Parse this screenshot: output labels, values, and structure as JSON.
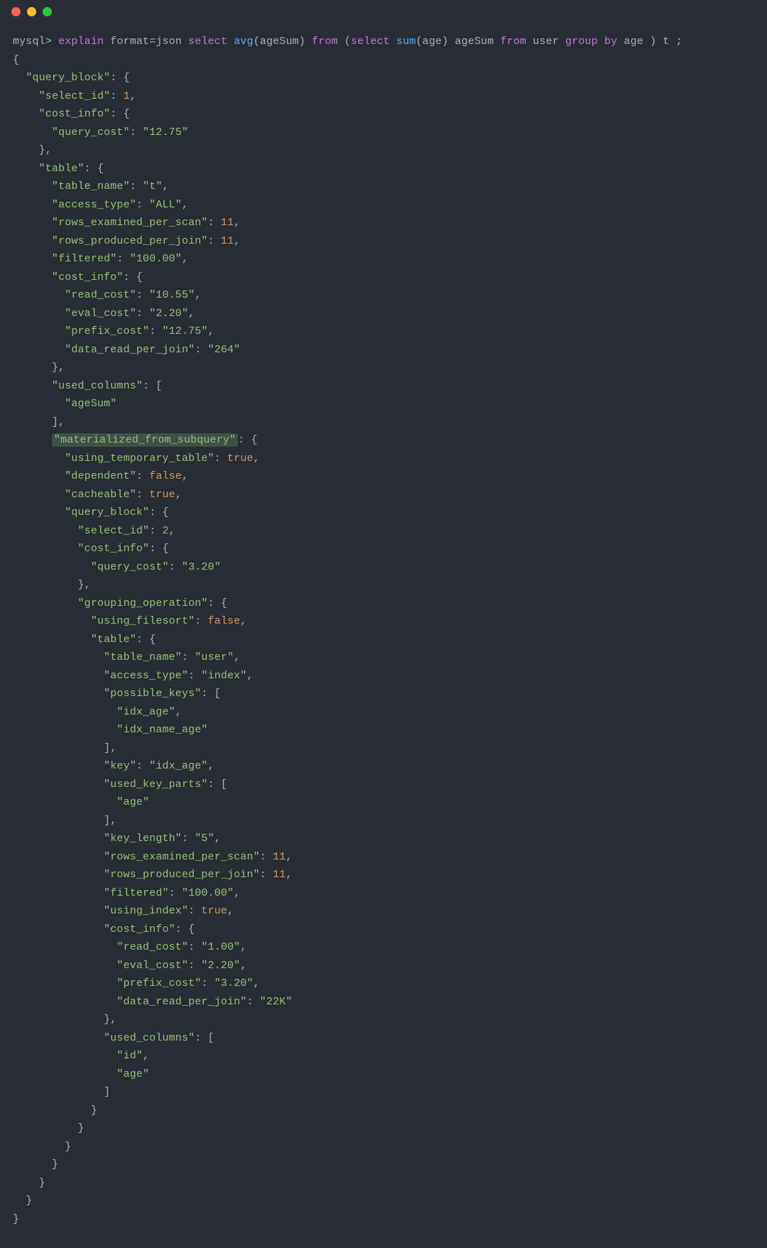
{
  "prompt": "mysql>",
  "command_tokens": [
    {
      "t": "explain",
      "c": "kw"
    },
    {
      "t": " ",
      "c": "pl"
    },
    {
      "t": "format",
      "c": "pl"
    },
    {
      "t": "=",
      "c": "pl"
    },
    {
      "t": "json",
      "c": "pl"
    },
    {
      "t": " ",
      "c": "pl"
    },
    {
      "t": "select",
      "c": "kw"
    },
    {
      "t": " ",
      "c": "pl"
    },
    {
      "t": "avg",
      "c": "bl"
    },
    {
      "t": "(ageSum) ",
      "c": "pl"
    },
    {
      "t": "from",
      "c": "kw"
    },
    {
      "t": " (",
      "c": "pl"
    },
    {
      "t": "select",
      "c": "kw"
    },
    {
      "t": " ",
      "c": "pl"
    },
    {
      "t": "sum",
      "c": "bl"
    },
    {
      "t": "(age) ageSum ",
      "c": "pl"
    },
    {
      "t": "from",
      "c": "kw"
    },
    {
      "t": " user ",
      "c": "pl"
    },
    {
      "t": "group by",
      "c": "kw"
    },
    {
      "t": " age ) t ;",
      "c": "pl"
    }
  ],
  "highlighted_key": "materialized_from_subquery",
  "explain_result": {
    "query_block": {
      "select_id": 1,
      "cost_info": {
        "query_cost": "12.75"
      },
      "table": {
        "table_name": "t",
        "access_type": "ALL",
        "rows_examined_per_scan": 11,
        "rows_produced_per_join": 11,
        "filtered": "100.00",
        "cost_info": {
          "read_cost": "10.55",
          "eval_cost": "2.20",
          "prefix_cost": "12.75",
          "data_read_per_join": "264"
        },
        "used_columns": [
          "ageSum"
        ],
        "materialized_from_subquery": {
          "using_temporary_table": true,
          "dependent": false,
          "cacheable": true,
          "query_block": {
            "select_id": 2,
            "cost_info": {
              "query_cost": "3.20"
            },
            "grouping_operation": {
              "using_filesort": false,
              "table": {
                "table_name": "user",
                "access_type": "index",
                "possible_keys": [
                  "idx_age",
                  "idx_name_age"
                ],
                "key": "idx_age",
                "used_key_parts": [
                  "age"
                ],
                "key_length": "5",
                "rows_examined_per_scan": 11,
                "rows_produced_per_join": 11,
                "filtered": "100.00",
                "using_index": true,
                "cost_info": {
                  "read_cost": "1.00",
                  "eval_cost": "2.20",
                  "prefix_cost": "3.20",
                  "data_read_per_join": "22K"
                },
                "used_columns": [
                  "id",
                  "age"
                ]
              }
            }
          }
        }
      }
    }
  }
}
